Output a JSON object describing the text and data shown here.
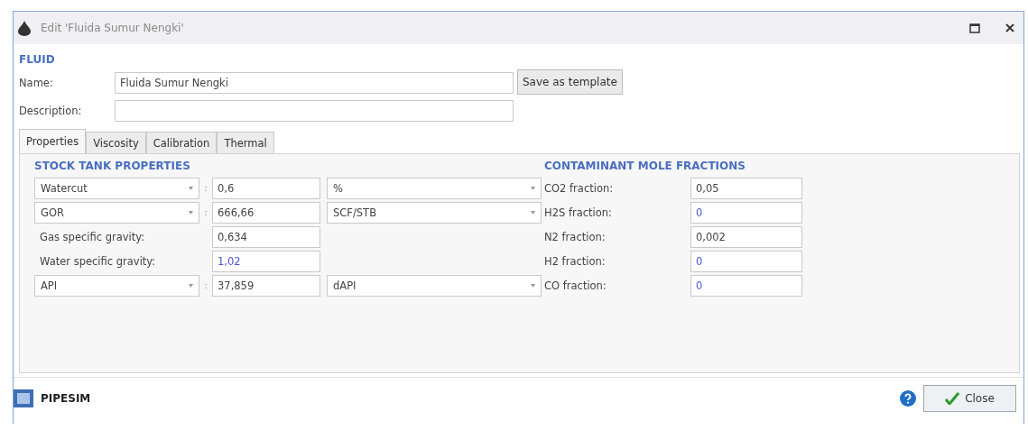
{
  "window": {
    "title": "Edit 'Fluida Sumur Nengki'"
  },
  "fluid": {
    "heading": "FLUID",
    "name_label": "Name:",
    "name_value": "Fluida Sumur Nengki",
    "save_button": "Save as template",
    "description_label": "Description:"
  },
  "tabs": [
    {
      "label": "Properties",
      "selected": true
    },
    {
      "label": "Viscosity",
      "selected": false
    },
    {
      "label": "Calibration",
      "selected": false
    },
    {
      "label": "Thermal",
      "selected": false
    }
  ],
  "stock_tank": {
    "heading": "STOCK TANK PROPERTIES",
    "rows": [
      {
        "kind": "select",
        "property": "Watercut",
        "separator": ":",
        "value": "0,6",
        "default": false,
        "unit": "%"
      },
      {
        "kind": "select",
        "property": "GOR",
        "separator": ":",
        "value": "666,66",
        "default": false,
        "unit": "SCF/STB"
      },
      {
        "kind": "field",
        "label": "Gas specific gravity:",
        "value": "0,634",
        "default": false
      },
      {
        "kind": "field",
        "label": "Water specific gravity:",
        "value": "1,02",
        "default": true
      },
      {
        "kind": "select",
        "property": "API",
        "separator": ":",
        "value": "37,859",
        "default": false,
        "unit": "dAPI"
      }
    ]
  },
  "contaminants": {
    "heading": "CONTAMINANT MOLE FRACTIONS",
    "rows": [
      {
        "label": "CO2 fraction:",
        "value": "0,05",
        "default": false
      },
      {
        "label": "H2S fraction:",
        "value": "0",
        "default": true
      },
      {
        "label": "N2 fraction:",
        "value": "0,002",
        "default": false
      },
      {
        "label": "H2 fraction:",
        "value": "0",
        "default": true
      },
      {
        "label": "CO fraction:",
        "value": "0",
        "default": true
      }
    ]
  },
  "footer": {
    "brand": "PIPESIM",
    "close_button": "Close"
  }
}
